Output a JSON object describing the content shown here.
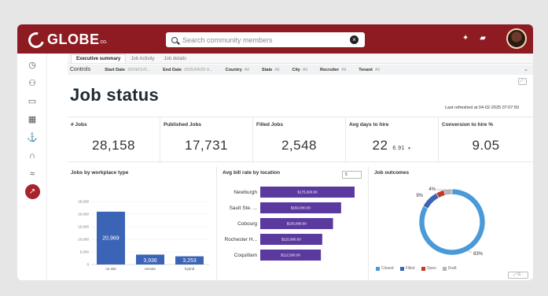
{
  "app": {
    "name": "GLOBE",
    "suffix": "co."
  },
  "search": {
    "placeholder": "Search community members"
  },
  "tabs": [
    "Executive summary",
    "Job Activity",
    "Job details"
  ],
  "controls": {
    "title": "Controls",
    "filters": [
      {
        "label": "Start Date",
        "value": "2024/01/0..."
      },
      {
        "label": "End Date",
        "value": "2025/04/25 0..."
      },
      {
        "label": "Country",
        "value": "All"
      },
      {
        "label": "State",
        "value": "All"
      },
      {
        "label": "City",
        "value": "All"
      },
      {
        "label": "Recruiter",
        "value": "All"
      },
      {
        "label": "Tenant",
        "value": "All"
      }
    ]
  },
  "page": {
    "title": "Job status",
    "refreshed": "Last refreshed at 04-02-2025 07:07:50"
  },
  "sidebar": {
    "icons": [
      "dashboard-icon",
      "users-icon",
      "briefcase-icon",
      "calendar-icon",
      "anchor-icon",
      "headset-icon",
      "network-icon",
      "analytics-icon"
    ],
    "active_index": 7
  },
  "kpis": [
    {
      "label": "# Jobs",
      "value": "28,158"
    },
    {
      "label": "Published Jobs",
      "value": "17,731"
    },
    {
      "label": "Filled Jobs",
      "value": "2,548"
    },
    {
      "label": "Avg days to hire",
      "value": "22",
      "sub": "6.91"
    },
    {
      "label": "Conversion to hire %",
      "value": "9.05"
    }
  ],
  "panels": {
    "workplace": {
      "title": "Jobs by workplace type"
    },
    "bill": {
      "title": "Avg bill rate by location",
      "input_value": "5"
    },
    "outcomes": {
      "title": "Job outcomes"
    }
  },
  "chart_data": [
    {
      "type": "bar",
      "title": "Jobs by workplace type",
      "categories": [
        "on-site",
        "remote",
        "hybrid"
      ],
      "values": [
        20969,
        3936,
        3253
      ],
      "value_labels": [
        "20,969",
        "3,936",
        "3,253"
      ],
      "ylim": [
        0,
        25000
      ],
      "yticks": [
        "0",
        "5,000",
        "10,000",
        "15,000",
        "20,000",
        "25,000"
      ],
      "color": "#3b63b6"
    },
    {
      "type": "bar",
      "orientation": "horizontal",
      "title": "Avg bill rate by location",
      "categories": [
        "Newburgh",
        "Sault Ste. ...",
        "Cobourg",
        "Rochester H...",
        "Coquitlam"
      ],
      "values": [
        175000,
        150000,
        135000,
        115000,
        112500
      ],
      "value_labels": [
        "$175,000.00",
        "$150,000.00",
        "$135,000.00",
        "$115,000.00",
        "$112,500.00"
      ],
      "color": "#5b3aa0"
    },
    {
      "type": "pie",
      "title": "Job outcomes",
      "categories": [
        "Closed",
        "Filled",
        "Open",
        "Draft"
      ],
      "values": [
        83,
        9,
        4,
        4
      ],
      "labels_shown": [
        "83%",
        "9%",
        "4%"
      ],
      "colors": [
        "#4b9ad8",
        "#3b63b6",
        "#c0392b",
        "#b5b5b5"
      ]
    }
  ]
}
